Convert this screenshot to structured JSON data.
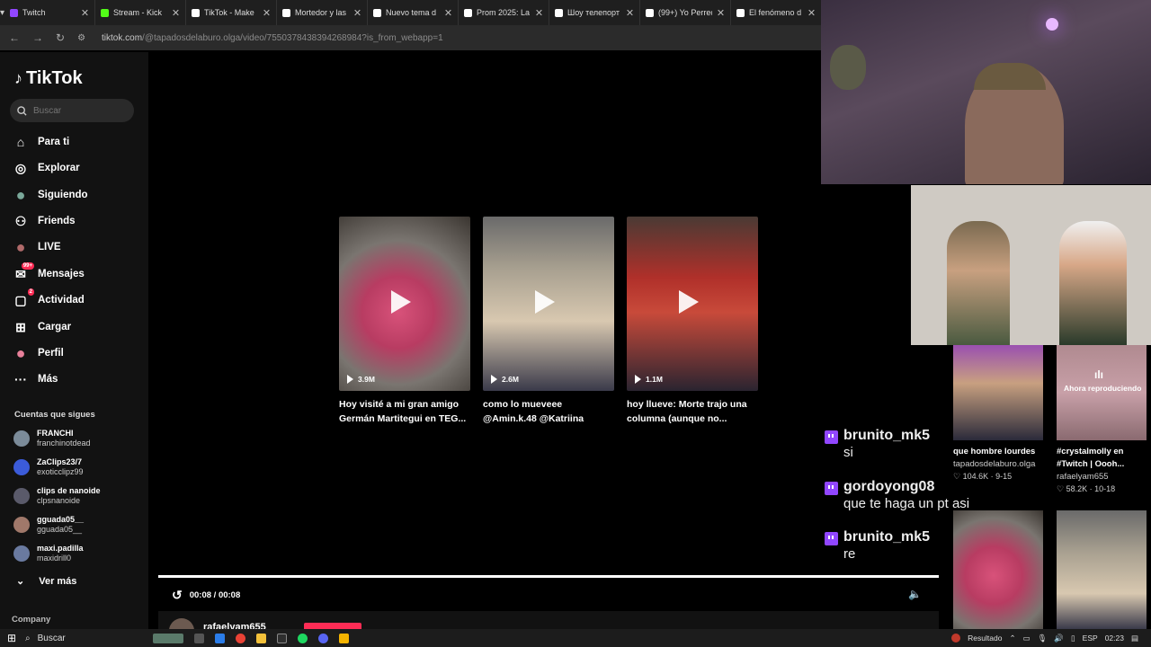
{
  "browser": {
    "tabs": [
      {
        "label": "Twitch",
        "color": "#9146ff"
      },
      {
        "label": "Stream - Kick",
        "color": "#53fc18"
      },
      {
        "label": "TikTok - Make",
        "color": "#ffffff"
      },
      {
        "label": "Mortedor y las",
        "color": "#ffffff"
      },
      {
        "label": "Nuevo tema d",
        "color": "#ffffff"
      },
      {
        "label": "Prom 2025: La",
        "color": "#ffffff"
      },
      {
        "label": "Шоу телепорт",
        "color": "#ffffff"
      },
      {
        "label": "(99+) Yo Perrec",
        "color": "#ffffff"
      },
      {
        "label": "El fenómeno d",
        "color": "#ffffff"
      }
    ],
    "url_host": "tiktok.com",
    "url_path": "/@tapadosdelaburo.olga/video/7550378438394268984?is_from_webapp=1"
  },
  "sidebar": {
    "logo": "TikTok",
    "search_placeholder": "Buscar",
    "nav": [
      {
        "label": "Para ti",
        "icon": "home-icon"
      },
      {
        "label": "Explorar",
        "icon": "compass-icon"
      },
      {
        "label": "Siguiendo",
        "icon": "following-avatar-icon"
      },
      {
        "label": "Friends",
        "icon": "friends-icon"
      },
      {
        "label": "LIVE",
        "icon": "live-icon"
      },
      {
        "label": "Mensajes",
        "icon": "messages-icon",
        "badge": "99+"
      },
      {
        "label": "Actividad",
        "icon": "activity-icon",
        "badge": "2"
      },
      {
        "label": "Cargar",
        "icon": "upload-icon"
      },
      {
        "label": "Perfil",
        "icon": "profile-icon"
      },
      {
        "label": "Más",
        "icon": "more-icon"
      }
    ],
    "follows_title": "Cuentas que sigues",
    "follows": [
      {
        "name": "FRANCHI",
        "user": "franchinotdead",
        "color": "#7b8b99"
      },
      {
        "name": "ZaClips23/7",
        "user": "exoticclipz99",
        "color": "#3b5bd9"
      },
      {
        "name": "clips de nanoide",
        "user": "clpsnanoide",
        "color": "#5a5a6a"
      },
      {
        "name": "gguada05__",
        "user": "gguada05__",
        "color": "#a0786a"
      },
      {
        "name": "maxi.padilla",
        "user": "maxidrill0",
        "color": "#6a7aa0"
      }
    ],
    "see_more": "Ver más",
    "company": "Company"
  },
  "videos": [
    {
      "views": "3.9M",
      "caption_1": "Hoy visité a mi gran amigo",
      "caption_2": "Germán Martitegui en TEG..."
    },
    {
      "views": "2.6M",
      "caption_1": "como lo mueveee",
      "caption_2": "@Amin.k.48 @Katriina"
    },
    {
      "views": "1.1M",
      "caption_1": "hoy llueve: Morte trajo una",
      "caption_2": "columna (aunque no..."
    }
  ],
  "player": {
    "time": "00:08 / 00:08",
    "uploader": "rafaelyam655"
  },
  "chat": [
    {
      "user": "brunito_mk5",
      "message": "si"
    },
    {
      "user": "gordoyong08",
      "message": "que te haga un pt asi"
    },
    {
      "user": "brunito_mk5",
      "message": "re"
    }
  ],
  "related": [
    {
      "title": "que hombre lourdes",
      "author": "tapadosdelaburo.olga",
      "stats": "104.6K · 9-15"
    },
    {
      "title_1": "#crystalmolly en",
      "title_2": "#Twitch | Oooh...",
      "author": "rafaelyam655",
      "stats": "58.2K · 10-18",
      "overlay": "Ahora reproduciendo"
    }
  ],
  "taskbar": {
    "search": "Buscar",
    "result": "Resultado",
    "lang": "ESP",
    "clock": "02:23"
  }
}
